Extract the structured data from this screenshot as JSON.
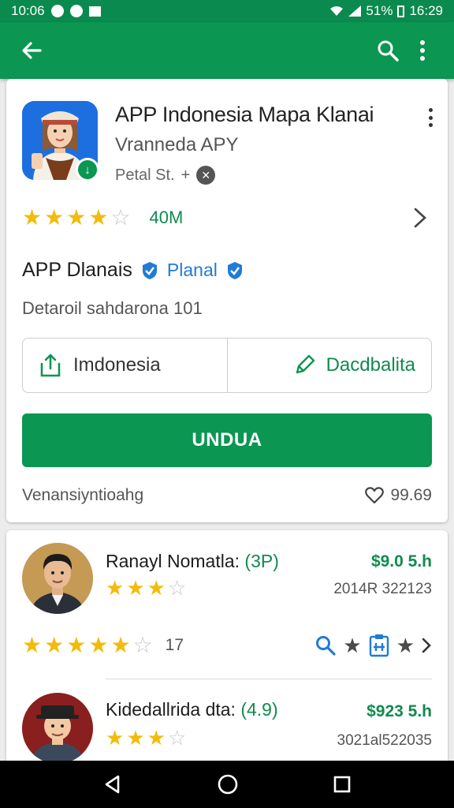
{
  "status_bar": {
    "time_left": "10:06",
    "battery": "51%",
    "time_right": "16:29"
  },
  "app_bar": {
    "back_icon": "arrow-left-icon",
    "search_icon": "search-icon",
    "more_icon": "more-vert-icon"
  },
  "app": {
    "title": "APP Indonesia Mapa Klanai",
    "subtitle": "Vranneda APY",
    "publisher": "Petal St.",
    "rating": {
      "stars_filled": 4,
      "count": "40M"
    },
    "developer": {
      "name": "APP Dlanais",
      "tag": "Planal"
    },
    "detail": "Detaroil sahdarona 101",
    "split_left": "Imdonesia",
    "split_right": "Dacdbalita",
    "install_label": "UNDUA",
    "footer_left": "Venansiyntioahg",
    "footer_likes": "99.69"
  },
  "reviews": [
    {
      "name": "Ranayl Nomatla:",
      "paren": "(3P)",
      "price": "$9.0 5.h",
      "stars_filled": 3,
      "date": "2014R 322123",
      "row_count": "17"
    },
    {
      "name": "Kidedallrida dta:",
      "paren": "(4.9)",
      "price": "$923 5.h",
      "stars_filled": 3,
      "date": "3021al522035"
    }
  ],
  "colors": {
    "accent": "#0b9652",
    "status": "#0a8a4e",
    "star": "#f3bb0a",
    "link": "#1f7bd8"
  }
}
